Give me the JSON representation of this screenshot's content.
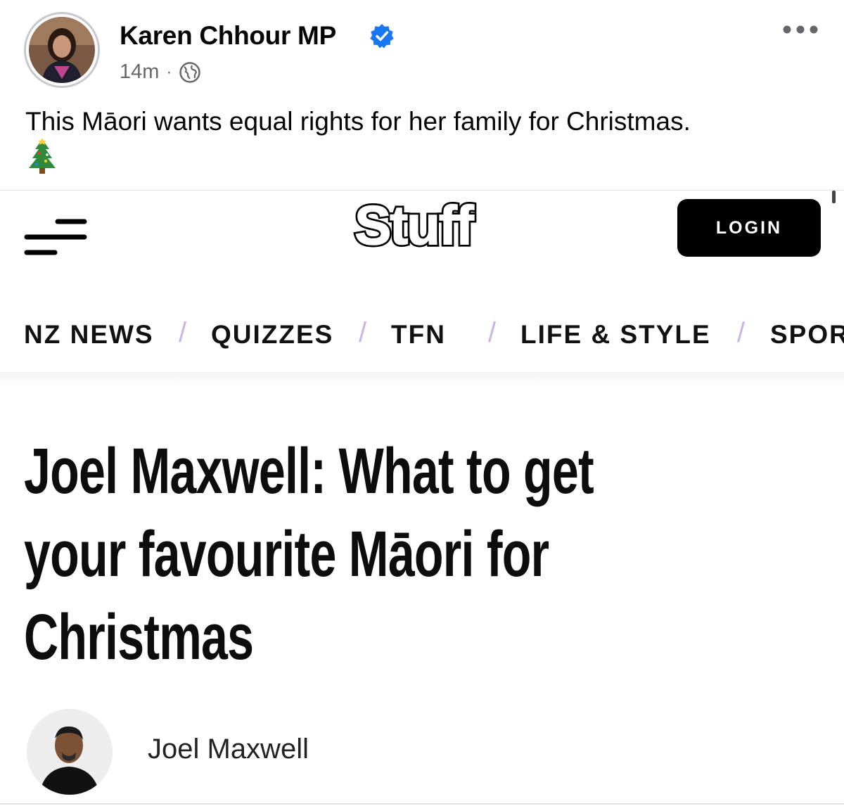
{
  "post": {
    "author": "Karen Chhour MP",
    "time": "14m",
    "separator": "·",
    "text": "This Māori wants equal rights for her family for Christmas.",
    "emoji": "christmas-tree"
  },
  "site": {
    "logo_text": "Stuff",
    "login_label": "LOGIN",
    "nav": [
      "NZ NEWS",
      "QUIZZES",
      "TFN",
      "LIFE & STYLE",
      "SPOR"
    ],
    "nav_separator": "/",
    "headline": [
      "Joel Maxwell: What to get",
      "your favourite Māori for",
      "Christmas"
    ],
    "byline": "Joel Maxwell"
  },
  "colors": {
    "verified": "#1877f2",
    "meta_gray": "#65676b",
    "nav_separator": "#c9b3ea",
    "login_bg": "#000000"
  }
}
